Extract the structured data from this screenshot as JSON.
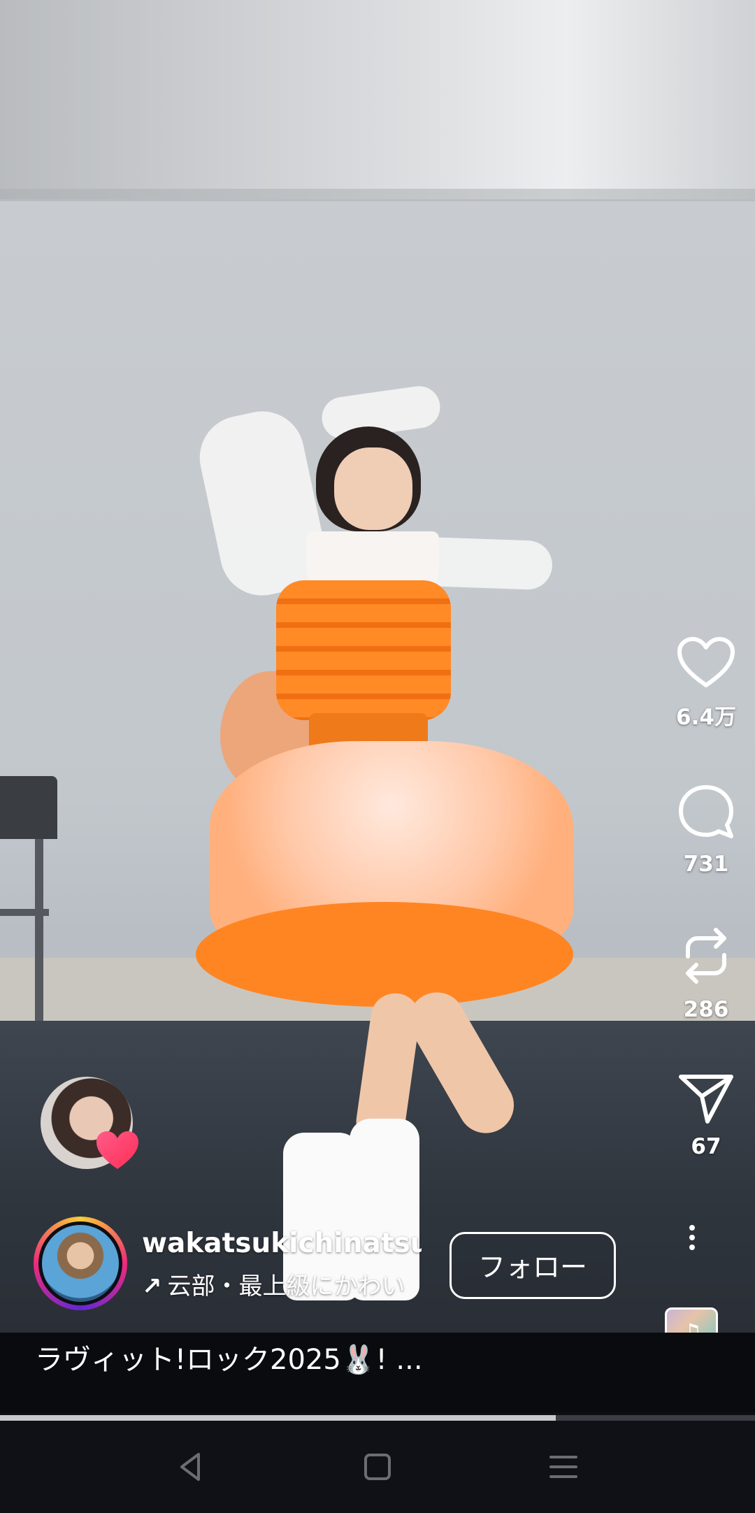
{
  "actions": {
    "like": {
      "icon": "heart-outline-icon",
      "count": "6.4万"
    },
    "comment": {
      "icon": "comment-bubble-icon",
      "count": "731"
    },
    "repost": {
      "icon": "repost-icon",
      "count": "286"
    },
    "share": {
      "icon": "paper-plane-icon",
      "count": "67"
    },
    "more": {
      "icon": "more-vertical-icon"
    },
    "music": {
      "icon": "music-note-icon",
      "note": "♫"
    }
  },
  "author": {
    "username": "wakatsukichinatsu ...",
    "subline": "云部・最上級にかわい",
    "subline_arrow": "↗",
    "follow_label": "フォロー"
  },
  "collaborator": {
    "badge_icon": "heart-icon",
    "badge_color": "#ff3d6e"
  },
  "caption": "ラヴィット!ロック2025🐰! ...",
  "progress": {
    "percent": 73.6
  },
  "system_nav": {
    "back": "back-triangle-icon",
    "home": "home-square-icon",
    "recents": "recents-menu-icon"
  },
  "colors": {
    "accent_ring": [
      "#f9ce34",
      "#ee2a7b",
      "#6228d7"
    ],
    "caption_bg": "#0a0b0e",
    "nav_bg": "#0f1116"
  }
}
